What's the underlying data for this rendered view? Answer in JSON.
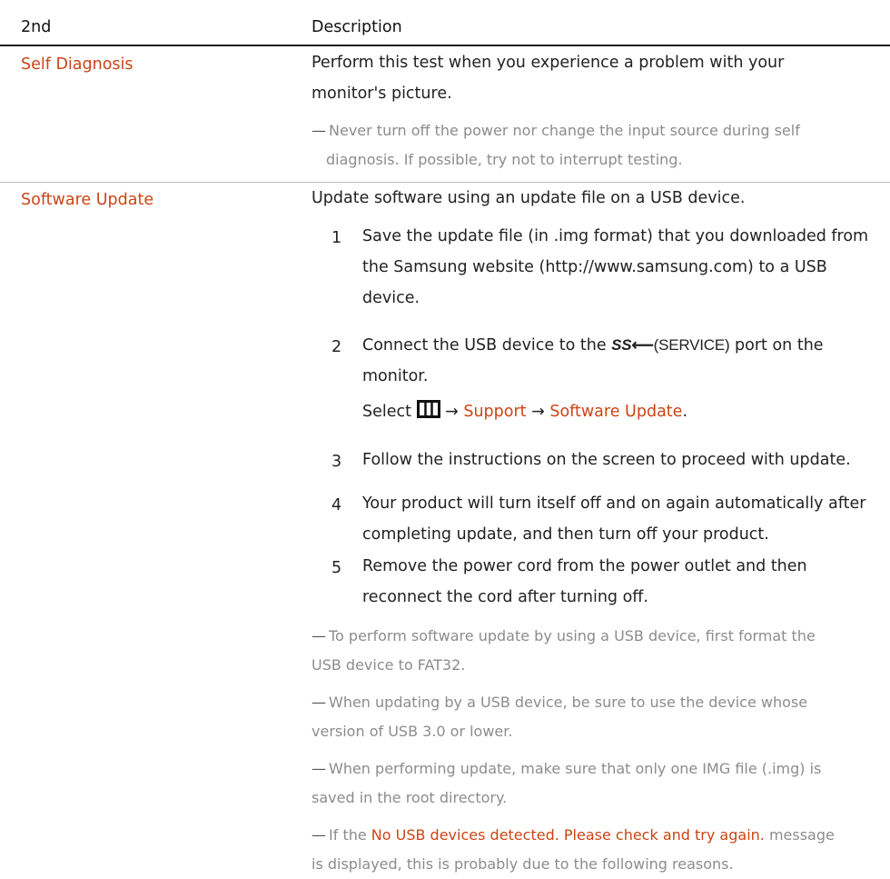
{
  "header": {
    "col1": "2nd",
    "col2": "Description"
  },
  "self_diagnosis": {
    "label": "Self Diagnosis",
    "line1": "Perform this test when you experience a problem with your",
    "line2": "monitor's picture.",
    "note_line1": "Never turn off the power nor change the input source during self",
    "note_line2": "diagnosis. If possible, try not to interrupt testing."
  },
  "software_update": {
    "label": "Software Update",
    "intro": "Update software using an update file on a USB device.",
    "steps": [
      {
        "num": "1",
        "line1": "Save the update file (in .img format) that you downloaded from",
        "line2": "the Samsung website (http://www.samsung.com) to a USB",
        "line3": "device."
      },
      {
        "num": "2",
        "pre": "Connect the USB device to the ",
        "port": "(SERVICE)",
        "post": " port on the",
        "line2": "monitor.",
        "select_pre": "Select ",
        "arrow1": " → ",
        "menu1": "Support",
        "arrow2": " → ",
        "menu2": "Software Update",
        "select_end": "."
      },
      {
        "num": "3",
        "line1": "Follow the instructions on the screen to proceed with update."
      },
      {
        "num": "4",
        "line1": "Your product will turn itself off and on again automatically after",
        "line2": "completing update, and then turn off your product."
      },
      {
        "num": "5",
        "line1": "Remove the power cord from the power outlet and then",
        "line2": "reconnect the cord after turning off."
      }
    ],
    "notes": [
      {
        "line1": "To perform software update by using a USB device, first format the",
        "line2": "USB device to FAT32."
      },
      {
        "line1": "When updating by a USB device, be sure to use the device whose",
        "line2": "version of USB 3.0 or lower."
      },
      {
        "line1": "When performing update, make sure that only one IMG file (.img) is",
        "line2": "saved in the root directory."
      },
      {
        "pre": "If the ",
        "highlight": "No USB devices detected. Please check and try again.",
        "post": " message",
        "line2": "is displayed, this is probably due to the following reasons."
      }
    ]
  },
  "icons": {
    "note_mark": "—",
    "usb_ss": "SS",
    "usb_arrow": "⟵",
    "menu_icon": "menu-icon"
  },
  "colors": {
    "accent": "#cc4414",
    "text": "#222222",
    "note": "#8c8c8c"
  }
}
